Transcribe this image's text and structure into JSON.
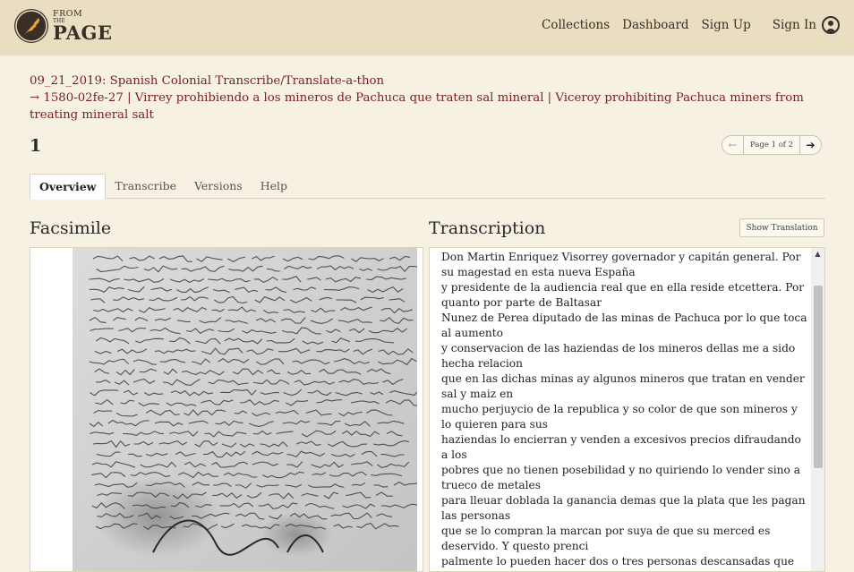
{
  "header": {
    "logo": {
      "line1": "FROM",
      "line2": "THE",
      "line3": "PAGE"
    },
    "nav": [
      {
        "label": "Collections"
      },
      {
        "label": "Dashboard"
      },
      {
        "label": "Sign Up"
      },
      {
        "label": "Sign In"
      }
    ],
    "user_icon": "user-circle-icon"
  },
  "breadcrumb": {
    "collection": "09_21_2019: Spanish Colonial Transcribe/Translate-a-thon",
    "arrow": "→",
    "work": "1580-02fe-27 | Virrey prohibiendo a los mineros de Pachuca que traten sal mineral | Viceroy prohibiting Pachuca miners from treating mineral salt"
  },
  "page": {
    "title": "1",
    "pager": {
      "prev_icon": "arrow-left-icon",
      "label": "Page 1 of 2",
      "next_icon": "arrow-right-icon"
    }
  },
  "tabs": [
    {
      "label": "Overview",
      "active": true
    },
    {
      "label": "Transcribe",
      "active": false
    },
    {
      "label": "Versions",
      "active": false
    },
    {
      "label": "Help",
      "active": false
    }
  ],
  "facsimile": {
    "title": "Facsimile"
  },
  "transcription": {
    "title": "Transcription",
    "show_translation_label": "Show Translation",
    "lines": [
      "Don Martin Enriquez Visorrey governador y capitán general. Por su magestad en esta nueva España",
      "y presidente de la audiencia real que en ella reside etcettera. Por quanto por parte de Baltasar",
      "Nunez de Perea diputado de las minas de Pachuca por lo que toca al aumento",
      "y conservacion de las haziendas de los mineros dellas me a sido hecha relacion",
      "que en las dichas minas ay algunos mineros que tratan en vender sal y maiz en",
      "mucho perjuycio de la republica y so color de que son mineros y lo quieren para sus",
      "haziendas lo encierran y venden a excesivos precios difraudando a los",
      "pobres que no tienen posebilidad y no quiriendo lo vender sino a trueco de metales",
      "para lleuar doblada la ganancia demas que la plata que les pagan las personas",
      "que se lo compran la marcan por suya de que su merced es deservido. Y questo prenci",
      "palmente lo pueden hacer dos o tres personas descansadas que no"
    ]
  },
  "colors": {
    "header_bg": "#e9ddc2",
    "page_bg": "#f6f1e3",
    "link": "#7a1d1d",
    "text": "#2a2a2a"
  }
}
